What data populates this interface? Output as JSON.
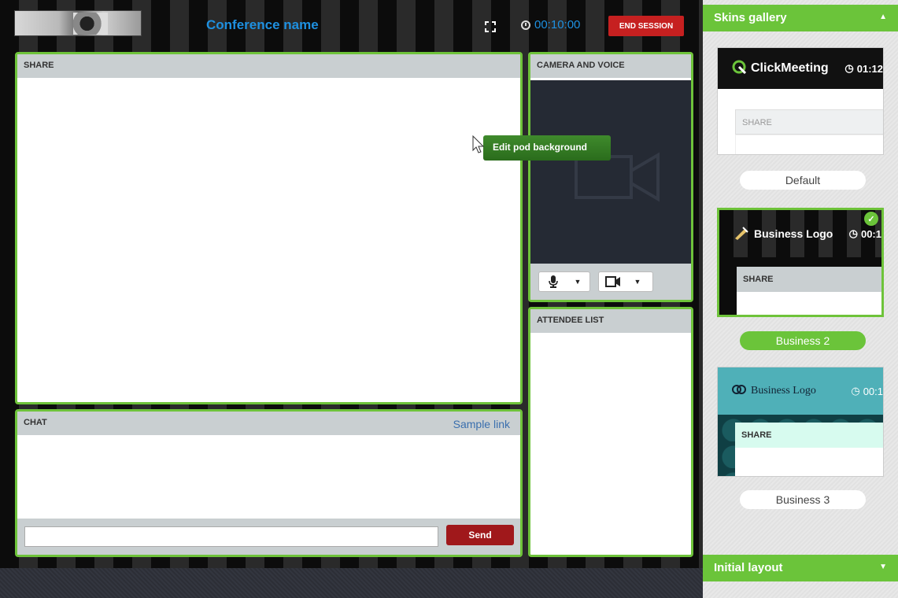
{
  "header": {
    "conference_name": "Conference name",
    "timer": "00:10:00",
    "end_session": "END SESSION"
  },
  "pods": {
    "share_title": "SHARE",
    "camera_title": "CAMERA AND VOICE",
    "attendee_title": "ATTENDEE LIST",
    "chat_title": "CHAT",
    "chat_link": "Sample link",
    "send_label": "Send"
  },
  "tooltip": "Edit pod background",
  "side_panel": {
    "skins_title": "Skins gallery",
    "initial_layout_title": "Initial layout",
    "skins": [
      {
        "logo_text": "ClickMeeting",
        "timer": "01:12",
        "pod_label": "SHARE",
        "name": "Default",
        "selected": false
      },
      {
        "logo_text": "Business Logo",
        "timer": "00:1",
        "pod_label": "SHARE",
        "name": "Business 2",
        "selected": true
      },
      {
        "logo_text": "Business Logo",
        "timer": "00:1",
        "pod_label": "SHARE",
        "name": "Business 3",
        "selected": false
      }
    ]
  },
  "colors": {
    "accent_green": "#6bc43a",
    "end_session_red": "#c62020",
    "title_blue": "#1e90e0"
  }
}
